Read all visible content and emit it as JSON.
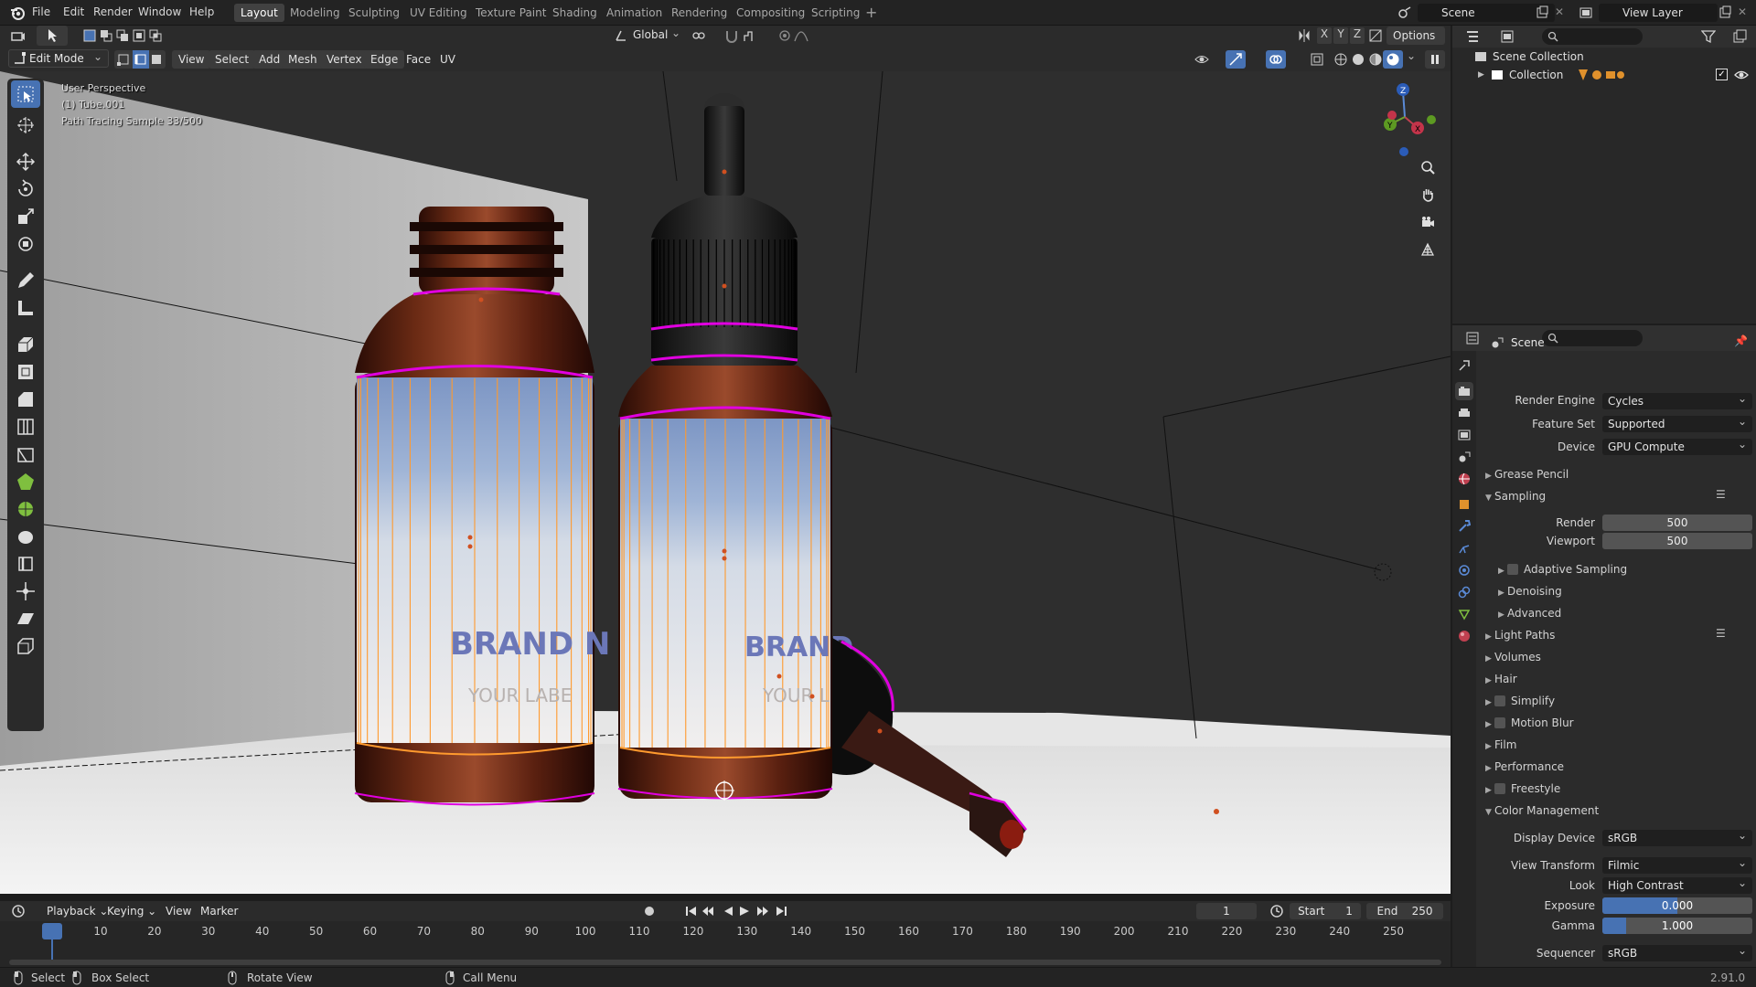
{
  "menu": {
    "items": [
      "File",
      "Edit",
      "Render",
      "Window",
      "Help"
    ]
  },
  "workspaces": {
    "tabs": [
      "Layout",
      "Modeling",
      "Sculpting",
      "UV Editing",
      "Texture Paint",
      "Shading",
      "Animation",
      "Rendering",
      "Compositing",
      "Scripting"
    ],
    "active": "Layout",
    "add_label": "+"
  },
  "scene": {
    "name": "Scene",
    "view_layer": "View Layer"
  },
  "viewport_header": {
    "mode": "Edit Mode",
    "menus": [
      "View",
      "Select",
      "Add",
      "Mesh",
      "Vertex",
      "Edge",
      "Face",
      "UV"
    ],
    "transform_orientation": "Global",
    "axes": [
      "X",
      "Y",
      "Z"
    ],
    "options_label": "Options"
  },
  "viewport_overlay": {
    "perspective": "User Perspective",
    "object": "(1) Tube.001",
    "sample": "Path Tracing Sample 33/500"
  },
  "scene_content": {
    "label_brand_left": "BRAND N",
    "label_sub_left": "YOUR LABE",
    "label_brand_right": "BRAND",
    "label_sub_right": "YOUR L"
  },
  "timeline": {
    "menus": [
      "Playback",
      "Keying",
      "View",
      "Marker"
    ],
    "current_frame": "1",
    "start_label": "Start",
    "start": "1",
    "end_label": "End",
    "end": "250",
    "ticks": [
      "1",
      "10",
      "20",
      "30",
      "40",
      "50",
      "60",
      "70",
      "80",
      "90",
      "100",
      "110",
      "120",
      "130",
      "140",
      "150",
      "160",
      "170",
      "180",
      "190",
      "200",
      "210",
      "220",
      "230",
      "240",
      "250"
    ]
  },
  "statusbar": {
    "select": "Select",
    "box_select": "Box Select",
    "rotate_view": "Rotate View",
    "call_menu": "Call Menu",
    "version": "2.91.0"
  },
  "outliner": {
    "scene_collection": "Scene Collection",
    "collection": "Collection"
  },
  "properties": {
    "context": "Scene",
    "render_engine_label": "Render Engine",
    "render_engine": "Cycles",
    "feature_set_label": "Feature Set",
    "feature_set": "Supported",
    "device_label": "Device",
    "device": "GPU Compute",
    "sections": {
      "grease_pencil": "Grease Pencil",
      "sampling": "Sampling",
      "adaptive_sampling": "Adaptive Sampling",
      "denoising": "Denoising",
      "advanced": "Advanced",
      "light_paths": "Light Paths",
      "volumes": "Volumes",
      "hair": "Hair",
      "simplify": "Simplify",
      "motion_blur": "Motion Blur",
      "film": "Film",
      "performance": "Performance",
      "freestyle": "Freestyle",
      "color_management": "Color Management"
    },
    "render_samples_label": "Render",
    "render_samples": "500",
    "viewport_samples_label": "Viewport",
    "viewport_samples": "500",
    "display_device_label": "Display Device",
    "display_device": "sRGB",
    "view_transform_label": "View Transform",
    "view_transform": "Filmic",
    "look_label": "Look",
    "look": "High Contrast",
    "exposure_label": "Exposure",
    "exposure": "0.000",
    "gamma_label": "Gamma",
    "gamma": "1.000",
    "sequencer_label": "Sequencer",
    "sequencer": "sRGB"
  },
  "colors": {
    "accent": "#4772b3",
    "edge_select": "#ff9a2e",
    "seam": "#ff00ff"
  }
}
